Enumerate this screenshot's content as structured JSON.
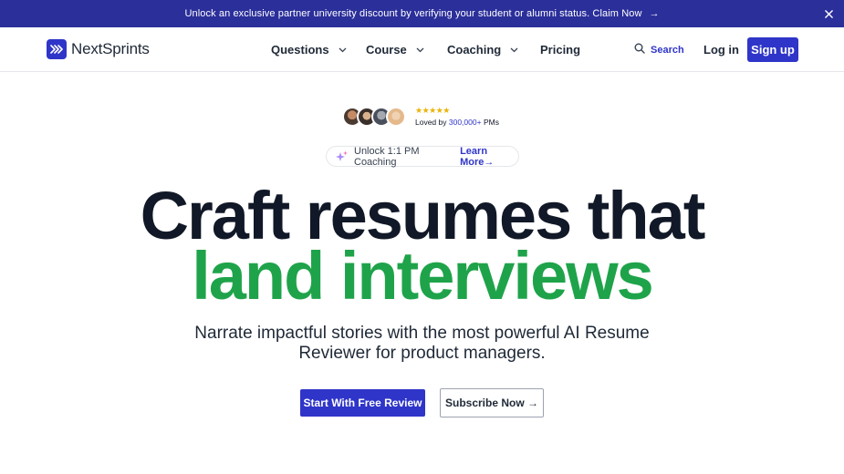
{
  "banner": {
    "text": "Unlock an exclusive partner university discount by verifying your student or alumni status. Claim Now",
    "arrow": "→",
    "close_icon": "close-icon"
  },
  "brand": {
    "name": "NextSprints",
    "accent_color": "#2f35c8",
    "highlight_color": "#1fa34a"
  },
  "nav": {
    "items": [
      {
        "label": "Questions",
        "has_dropdown": true
      },
      {
        "label": "Course",
        "has_dropdown": true
      },
      {
        "label": "Coaching",
        "has_dropdown": true
      },
      {
        "label": "Pricing",
        "has_dropdown": false
      }
    ],
    "search_label": "Search",
    "login_label": "Log in",
    "signup_label": "Sign up"
  },
  "social_proof": {
    "stars": "★★★★★",
    "loved_prefix": "Loved by",
    "count": "300,000+",
    "suffix": "PMs"
  },
  "pill": {
    "label": "Unlock 1:1 PM Coaching",
    "link": "Learn More→"
  },
  "hero": {
    "line1": "Craft resumes that",
    "line2": "land interviews",
    "subtitle": "Narrate impactful stories with the most powerful AI Resume Reviewer for product managers."
  },
  "cta": {
    "primary": "Start With Free Review",
    "secondary": "Subscribe Now →"
  }
}
